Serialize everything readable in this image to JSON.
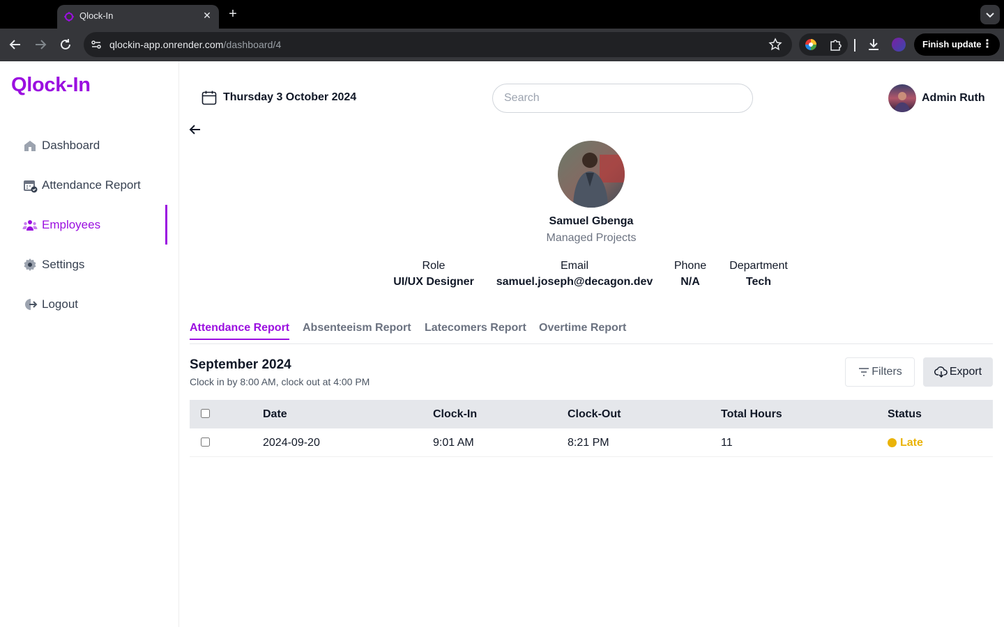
{
  "browser": {
    "tab_title": "Qlock-In",
    "url_host": "qlockin-app.onrender.com",
    "url_path": "/dashboard/4",
    "finish_update": "Finish update"
  },
  "brand": {
    "logo": "Qlock-In",
    "accent": "#9b0fe0"
  },
  "sidebar": {
    "items": [
      {
        "label": "Dashboard",
        "icon": "home-icon"
      },
      {
        "label": "Attendance Report",
        "icon": "calendar-check-icon"
      },
      {
        "label": "Employees",
        "icon": "users-icon",
        "active": true
      },
      {
        "label": "Settings",
        "icon": "gear-icon"
      },
      {
        "label": "Logout",
        "icon": "logout-icon"
      }
    ]
  },
  "header": {
    "date": "Thursday 3 October 2024",
    "search_placeholder": "Search",
    "user_name": "Admin Ruth"
  },
  "profile": {
    "name": "Samuel Gbenga",
    "subtitle": "Managed Projects",
    "fields": [
      {
        "label": "Role",
        "value": "UI/UX Designer"
      },
      {
        "label": "Email",
        "value": "samuel.joseph@decagon.dev"
      },
      {
        "label": "Phone",
        "value": "N/A"
      },
      {
        "label": "Department",
        "value": "Tech"
      }
    ]
  },
  "tabs": [
    {
      "label": "Attendance Report",
      "active": true
    },
    {
      "label": "Absenteeism Report"
    },
    {
      "label": "Latecomers Report"
    },
    {
      "label": "Overtime Report"
    }
  ],
  "report": {
    "title": "September 2024",
    "subtitle": "Clock in by 8:00 AM, clock out at 4:00 PM",
    "filter_label": "Filters",
    "export_label": "Export"
  },
  "table": {
    "columns": [
      "Date",
      "Clock-In",
      "Clock-Out",
      "Total Hours",
      "Status"
    ],
    "rows": [
      {
        "date": "2024-09-20",
        "clock_in": "9:01 AM",
        "clock_out": "8:21 PM",
        "total_hours": "11",
        "status": "Late",
        "status_color": "#eab308"
      }
    ]
  }
}
